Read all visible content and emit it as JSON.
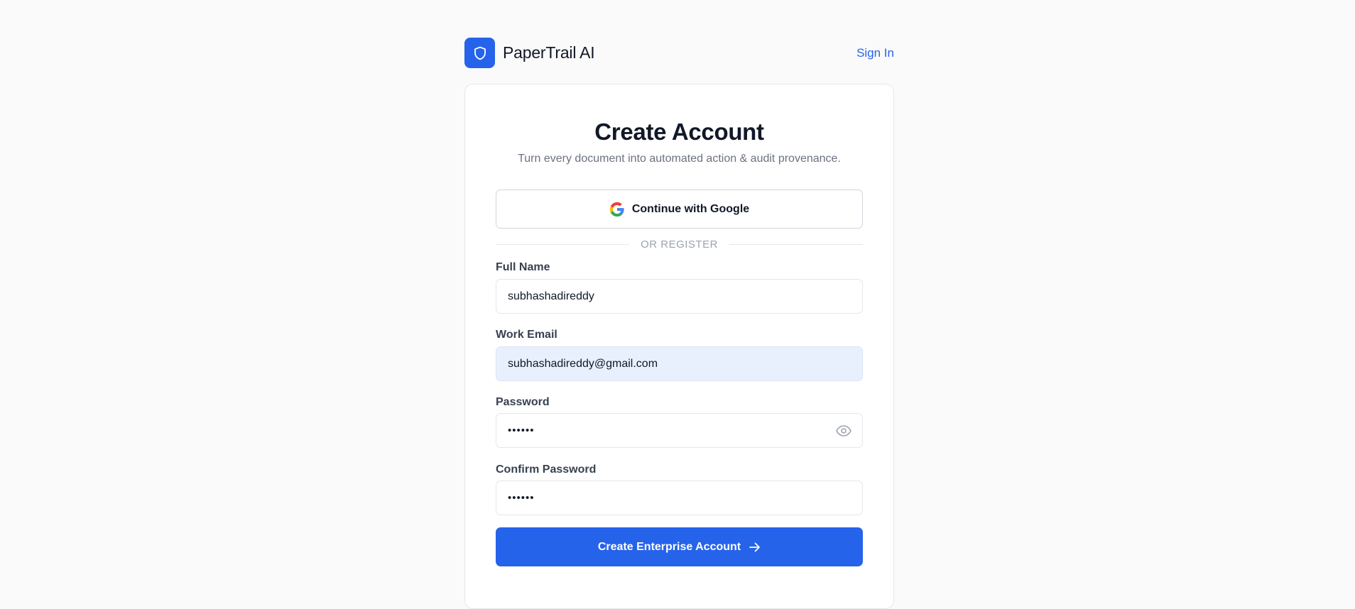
{
  "brand": {
    "name": "PaperTrail AI",
    "logo_icon": "shield-icon",
    "accent": "#2563eb"
  },
  "nav": {
    "signin_label": "Sign In"
  },
  "form": {
    "title": "Create Account",
    "subtitle": "Turn every document into automated action & audit provenance.",
    "google_label": "Continue with Google",
    "divider_text": "OR REGISTER",
    "full_name": {
      "label": "Full Name",
      "value": "subhashadireddy"
    },
    "email": {
      "label": "Work Email",
      "value": "subhashadireddy@gmail.com"
    },
    "password": {
      "label": "Password",
      "value": "••••••",
      "toggle_icon": "eye-icon"
    },
    "confirm_password": {
      "label": "Confirm Password",
      "value": "••••••"
    },
    "submit_label": "Create Enterprise Account",
    "submit_icon": "arrow-right-icon"
  }
}
